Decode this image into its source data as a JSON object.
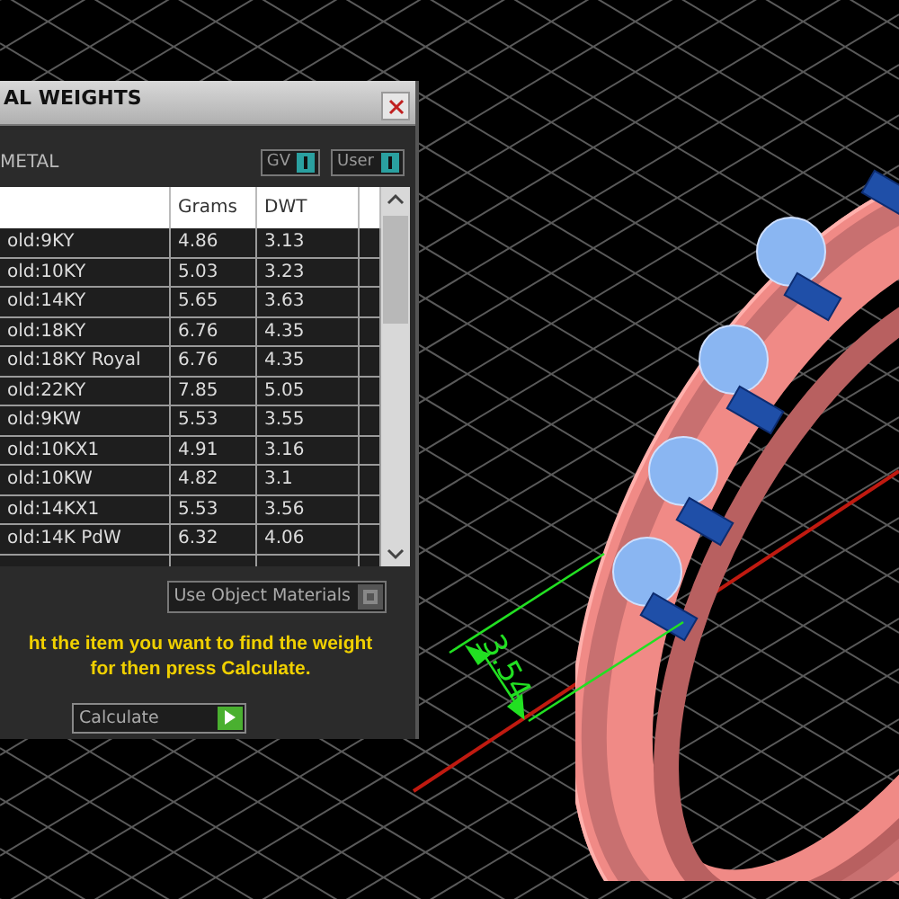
{
  "panel": {
    "title": "AL WEIGHTS",
    "section_label": "METAL",
    "toggles": [
      {
        "label": "GV",
        "on": true
      },
      {
        "label": "User",
        "on": true
      }
    ],
    "table": {
      "columns": [
        "Grams",
        "DWT"
      ],
      "rows": [
        {
          "name": "old:9KY",
          "grams": "4.86",
          "dwt": "3.13"
        },
        {
          "name": "old:10KY",
          "grams": "5.03",
          "dwt": "3.23"
        },
        {
          "name": "old:14KY",
          "grams": "5.65",
          "dwt": "3.63"
        },
        {
          "name": "old:18KY",
          "grams": "6.76",
          "dwt": "4.35"
        },
        {
          "name": "old:18KY Royal",
          "grams": "6.76",
          "dwt": "4.35"
        },
        {
          "name": "old:22KY",
          "grams": "7.85",
          "dwt": "5.05"
        },
        {
          "name": "old:9KW",
          "grams": "5.53",
          "dwt": "3.55"
        },
        {
          "name": "old:10KX1",
          "grams": "4.91",
          "dwt": "3.16"
        },
        {
          "name": "old:10KW",
          "grams": "4.82",
          "dwt": "3.1"
        },
        {
          "name": "old:14KX1",
          "grams": "5.53",
          "dwt": "3.56"
        },
        {
          "name": "old:14K PdW",
          "grams": "6.32",
          "dwt": "4.06"
        }
      ]
    },
    "option_button": {
      "label": "Use Object Materials",
      "on": false
    },
    "instruction_lines": [
      "ht the item you want to find the weight",
      "for then press Calculate."
    ],
    "calculate_button": "Calculate"
  },
  "viewport": {
    "dimension_label": "3.54"
  }
}
